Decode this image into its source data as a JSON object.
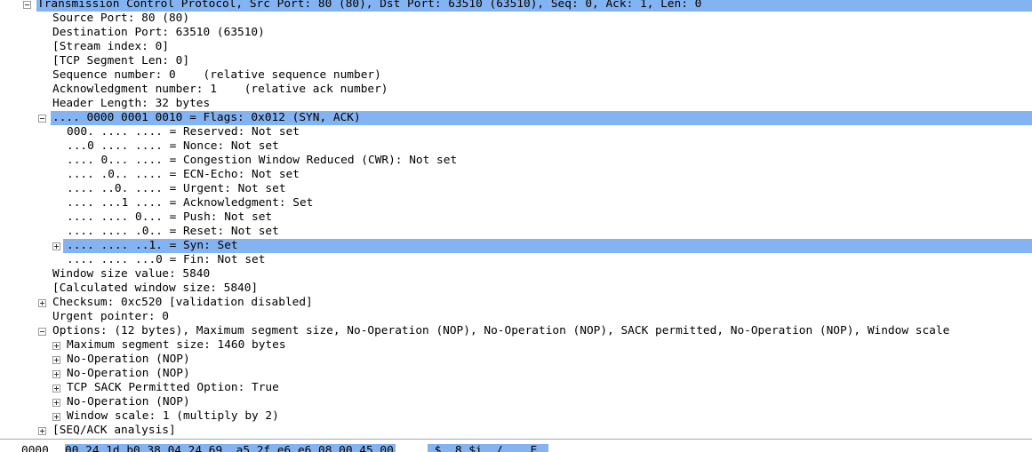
{
  "packet_details": [
    {
      "text": "Transmission Control Protocol, Src Port: 80 (80), Dst Port: 63510 (63510), Seq: 0, Ack: 1, Len: 0",
      "expander": "minus",
      "highlighted": true
    },
    {
      "text": "Source Port: 80 (80)",
      "expander": "none",
      "highlighted": false
    },
    {
      "text": "Destination Port: 63510 (63510)",
      "expander": "none",
      "highlighted": false
    },
    {
      "text": "[Stream index: 0]",
      "expander": "none",
      "highlighted": false
    },
    {
      "text": "[TCP Segment Len: 0]",
      "expander": "none",
      "highlighted": false
    },
    {
      "text": "Sequence number: 0    (relative sequence number)",
      "expander": "none",
      "highlighted": false
    },
    {
      "text": "Acknowledgment number: 1    (relative ack number)",
      "expander": "none",
      "highlighted": false
    },
    {
      "text": "Header Length: 32 bytes",
      "expander": "none",
      "highlighted": false
    },
    {
      "text": ".... 0000 0001 0010 = Flags: 0x012 (SYN, ACK)",
      "expander": "minus",
      "highlighted": true
    },
    {
      "text": "000. .... .... = Reserved: Not set",
      "expander": "none",
      "highlighted": false
    },
    {
      "text": "...0 .... .... = Nonce: Not set",
      "expander": "none",
      "highlighted": false
    },
    {
      "text": ".... 0... .... = Congestion Window Reduced (CWR): Not set",
      "expander": "none",
      "highlighted": false
    },
    {
      "text": ".... .0.. .... = ECN-Echo: Not set",
      "expander": "none",
      "highlighted": false
    },
    {
      "text": ".... ..0. .... = Urgent: Not set",
      "expander": "none",
      "highlighted": false
    },
    {
      "text": ".... ...1 .... = Acknowledgment: Set",
      "expander": "none",
      "highlighted": false
    },
    {
      "text": ".... .... 0... = Push: Not set",
      "expander": "none",
      "highlighted": false
    },
    {
      "text": ".... .... .0.. = Reset: Not set",
      "expander": "none",
      "highlighted": false
    },
    {
      "text": ".... .... ..1. = Syn: Set",
      "expander": "plus",
      "highlighted": true
    },
    {
      "text": ".... .... ...0 = Fin: Not set",
      "expander": "none",
      "highlighted": false
    },
    {
      "text": "Window size value: 5840",
      "expander": "none",
      "highlighted": false
    },
    {
      "text": "[Calculated window size: 5840]",
      "expander": "none",
      "highlighted": false
    },
    {
      "text": "Checksum: 0xc520 [validation disabled]",
      "expander": "plus",
      "highlighted": false
    },
    {
      "text": "Urgent pointer: 0",
      "expander": "none",
      "highlighted": false
    },
    {
      "text": "Options: (12 bytes), Maximum segment size, No-Operation (NOP), No-Operation (NOP), SACK permitted, No-Operation (NOP), Window scale",
      "expander": "minus",
      "highlighted": false
    },
    {
      "text": "Maximum segment size: 1460 bytes",
      "expander": "plus",
      "highlighted": false
    },
    {
      "text": "No-Operation (NOP)",
      "expander": "plus",
      "highlighted": false
    },
    {
      "text": "No-Operation (NOP)",
      "expander": "plus",
      "highlighted": false
    },
    {
      "text": "TCP SACK Permitted Option: True",
      "expander": "plus",
      "highlighted": false
    },
    {
      "text": "No-Operation (NOP)",
      "expander": "plus",
      "highlighted": false
    },
    {
      "text": "Window scale: 1 (multiply by 2)",
      "expander": "plus",
      "highlighted": false
    },
    {
      "text": "[SEQ/ACK analysis]",
      "expander": "plus",
      "highlighted": false
    }
  ],
  "hex_dump": {
    "offset": "0000",
    "bytes": "00 24 1d b0 38 04 24 69  a5 2f e6 e6 08 00 45 00",
    "ascii": ".$..8.$i ./....E."
  },
  "colors": {
    "selection": "#84b3f2",
    "background": "#ffffff"
  }
}
